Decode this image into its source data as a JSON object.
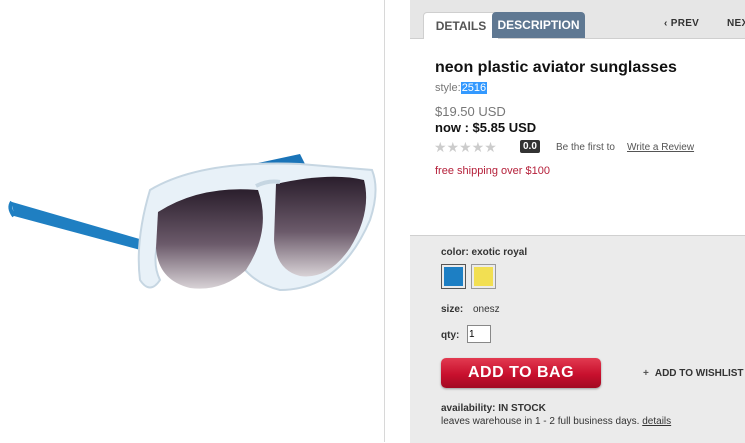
{
  "tabs": {
    "details": "DETAILS",
    "description": "DESCRIPTION"
  },
  "nav": {
    "prev": "PREV",
    "next": "NEX"
  },
  "product": {
    "title": "neon plastic aviator sunglasses",
    "style_label": "style:",
    "style_value": "2516",
    "original_price": "$19.50 USD",
    "sale_price": "now : $5.85 USD"
  },
  "rating": {
    "stars": "★★★★★",
    "score": "0.0",
    "first_text": "Be the first to",
    "write_review": "Write a Review",
    "star_value": 0
  },
  "shipping": "free shipping over $100",
  "options": {
    "color_label": "color: exotic royal",
    "swatches": [
      {
        "name": "exotic royal",
        "color": "#1d7fc4"
      },
      {
        "name": "yellow",
        "color": "#f2df52"
      }
    ],
    "size_label": "size:",
    "size_value": "onesz",
    "qty_label": "qty:",
    "qty_value": "1"
  },
  "actions": {
    "add_to_bag": "ADD TO BAG",
    "add_to_wishlist": "ADD TO WISHLIST",
    "plus": "+"
  },
  "availability": {
    "status": "availability: IN STOCK",
    "leaves": "leaves warehouse in 1 - 2 full business days.",
    "details": "details"
  },
  "colors": {
    "accent_red": "#c8102e",
    "tab_blue": "#5f7892",
    "shipping_red": "#b5203a"
  }
}
